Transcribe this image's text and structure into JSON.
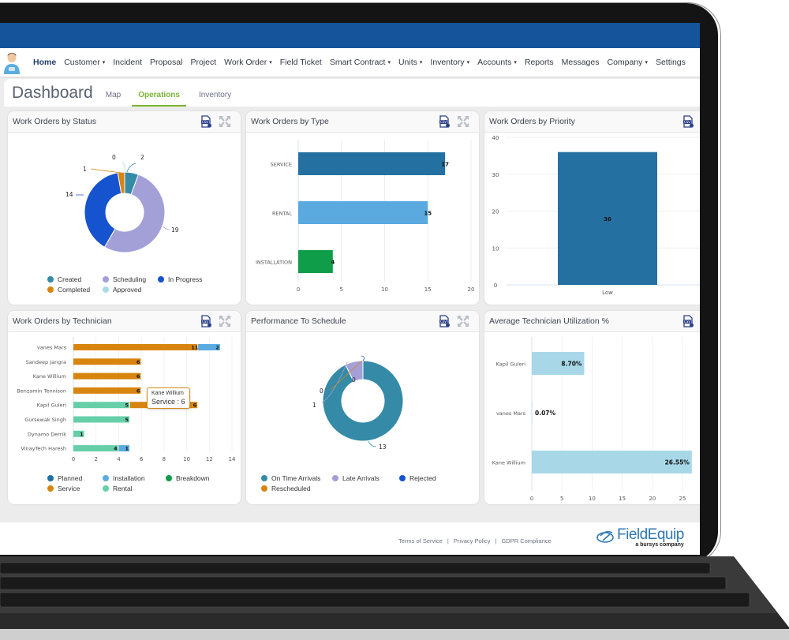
{
  "nav": {
    "items": [
      {
        "label": "Home",
        "active": true,
        "dropdown": false
      },
      {
        "label": "Customer",
        "dropdown": true
      },
      {
        "label": "Incident",
        "dropdown": false
      },
      {
        "label": "Proposal",
        "dropdown": false
      },
      {
        "label": "Project",
        "dropdown": false
      },
      {
        "label": "Work Order",
        "dropdown": true
      },
      {
        "label": "Field Ticket",
        "dropdown": false
      },
      {
        "label": "Smart Contract",
        "dropdown": true
      },
      {
        "label": "Units",
        "dropdown": true
      },
      {
        "label": "Inventory",
        "dropdown": true
      },
      {
        "label": "Accounts",
        "dropdown": true
      },
      {
        "label": "Reports",
        "dropdown": false
      },
      {
        "label": "Messages",
        "dropdown": false
      },
      {
        "label": "Company",
        "dropdown": true
      },
      {
        "label": "Settings",
        "dropdown": false
      }
    ],
    "caret": "▾"
  },
  "dashboard": {
    "title": "Dashboard",
    "tabs": [
      {
        "label": "Map",
        "active": false
      },
      {
        "label": "Operations",
        "active": true
      },
      {
        "label": "Inventory",
        "active": false
      }
    ]
  },
  "colors": {
    "topbar": "#15549a",
    "accent_green": "#7ab534",
    "created": "#348aa7",
    "scheduling": "#a3a0d8",
    "in_progress": "#1653cf",
    "completed": "#d8850f",
    "approved": "#a9dbe8",
    "service_type": "#2470a0",
    "rental_type": "#5aaae0",
    "installation_type": "#0f9d4a",
    "planned": "#1f6fa5",
    "installation": "#5aace0",
    "breakdown": "#0f9d4a",
    "service": "#d8850f",
    "rental": "#66cfa8",
    "utilization": "#a8d8e8"
  },
  "cards": {
    "status": {
      "title": "Work Orders by Status"
    },
    "type": {
      "title": "Work Orders by Type"
    },
    "priority": {
      "title": "Work Orders by Priority"
    },
    "technician": {
      "title": "Work Orders by Technician",
      "tooltip": {
        "name": "Kane Willium",
        "series": "Service",
        "value": 6,
        "text": "Service : 6"
      }
    },
    "performance": {
      "title": "Performance To Schedule"
    },
    "utilization": {
      "title": "Average Technician Utilization %"
    }
  },
  "icons": {
    "csv": "csv-export-icon",
    "expand": "expand-icon"
  },
  "chart_data": [
    {
      "id": "status",
      "type": "pie",
      "donut": true,
      "title": "Work Orders by Status",
      "slices": [
        {
          "label": "Created",
          "value": 2,
          "color": "#348aa7"
        },
        {
          "label": "Scheduling",
          "value": 19,
          "color": "#a3a0d8"
        },
        {
          "label": "In Progress",
          "value": 14,
          "color": "#1653cf"
        },
        {
          "label": "Completed",
          "value": 1,
          "color": "#d8850f"
        },
        {
          "label": "Approved",
          "value": 0,
          "color": "#a9dbe8"
        }
      ],
      "legend_rows": [
        [
          "Created",
          "Scheduling",
          "In Progress"
        ],
        [
          "Completed",
          "Approved"
        ]
      ],
      "legend": "bottom"
    },
    {
      "id": "type",
      "type": "bar",
      "orientation": "horizontal",
      "title": "Work Orders by Type",
      "categories": [
        "SERVICE",
        "RENTAL",
        "INSTALLATION"
      ],
      "values": [
        17,
        15,
        4
      ],
      "colors": [
        "#2470a0",
        "#5aaae0",
        "#0f9d4a"
      ],
      "xlim": [
        0,
        20
      ],
      "xticks": [
        0,
        5,
        10,
        15,
        20
      ],
      "grid": true
    },
    {
      "id": "priority",
      "type": "bar",
      "title": "Work Orders by Priority",
      "categories": [
        "Low"
      ],
      "values": [
        36
      ],
      "color": "#2470a0",
      "ylim": [
        0,
        40
      ],
      "yticks": [
        0,
        10,
        20,
        30,
        40
      ],
      "grid": true
    },
    {
      "id": "technician",
      "type": "bar",
      "orientation": "horizontal",
      "stacked": true,
      "title": "Work Orders by Technician",
      "categories": [
        "vanes Mars",
        "Sandeep Jangra",
        "Kane Willium",
        "Benzamin Tennison",
        "Kapil Guleri",
        "Gursewak Singh",
        "Dynamo Derrik",
        "VinayTech Haresh"
      ],
      "series": [
        {
          "name": "Rental",
          "color": "#66cfa8",
          "values": [
            0,
            0,
            0,
            0,
            5,
            5,
            1,
            4
          ]
        },
        {
          "name": "Service",
          "color": "#d8850f",
          "values": [
            11,
            6,
            6,
            6,
            6,
            0,
            0,
            0
          ]
        },
        {
          "name": "Installation",
          "color": "#5aace0",
          "values": [
            2,
            0,
            0,
            0,
            0,
            0,
            0,
            1
          ]
        },
        {
          "name": "Planned",
          "color": "#1f6fa5",
          "values": [
            0,
            0,
            0,
            0,
            0,
            0,
            0,
            0
          ]
        },
        {
          "name": "Breakdown",
          "color": "#0f9d4a",
          "values": [
            0,
            0,
            0,
            0,
            0,
            0,
            0,
            0
          ]
        }
      ],
      "xlim": [
        0,
        14
      ],
      "xticks": [
        0,
        2,
        4,
        6,
        8,
        10,
        12,
        14
      ],
      "legend_rows": [
        [
          "Planned",
          "Installation",
          "Breakdown"
        ],
        [
          "Service",
          "Rental"
        ]
      ],
      "legend": "bottom",
      "grid": true
    },
    {
      "id": "performance",
      "type": "pie",
      "donut": true,
      "title": "Performance To Schedule",
      "slices": [
        {
          "label": "On Time Arrivals",
          "value": 13,
          "color": "#348aa7"
        },
        {
          "label": "Late Arrivals",
          "value": 1,
          "color": "#a3a0d8"
        },
        {
          "label": "Rescheduled",
          "value": 0,
          "color": "#d8850f"
        },
        {
          "label": "Rejected",
          "value": 0,
          "color": "#1653cf"
        }
      ],
      "legend_rows": [
        [
          "On Time Arrivals",
          "Late Arrivals",
          "Rejected"
        ],
        [
          "Rescheduled"
        ]
      ],
      "legend": "bottom"
    },
    {
      "id": "utilization",
      "type": "bar",
      "orientation": "horizontal",
      "title": "Average Technician Utilization %",
      "categories": [
        "Kapil Guleri",
        "vanes Mars",
        "Kane Willium"
      ],
      "values": [
        8.7,
        0.07,
        26.55
      ],
      "labels": [
        "8.70%",
        "0.07%",
        "26.55%"
      ],
      "color": "#a8d8e8",
      "xlim": [
        0,
        27
      ],
      "xticks": [
        0,
        5,
        10,
        15,
        20,
        25
      ],
      "grid": true
    }
  ],
  "footer": {
    "links": [
      "Terms of Service",
      "Privacy Policy",
      "GDPR Compliance"
    ],
    "separator": "|",
    "brand": "FieldEquip",
    "brand_sub": "a bursys company"
  }
}
